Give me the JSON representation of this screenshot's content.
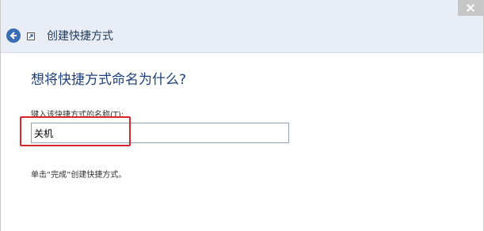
{
  "window": {
    "title": "创建快捷方式"
  },
  "main": {
    "heading": "想将快捷方式命名为什么?",
    "field_label": "键入该快捷方式的名称(T):",
    "name_value": "关机",
    "hint": "单击“完成”创建快捷方式。"
  },
  "icons": {
    "back": "back-arrow-icon",
    "shortcut": "shortcut-icon",
    "close": "close-icon"
  },
  "colors": {
    "header_bg": "#e9eef6",
    "accent": "#3a6db3",
    "highlight": "#d9262b"
  }
}
